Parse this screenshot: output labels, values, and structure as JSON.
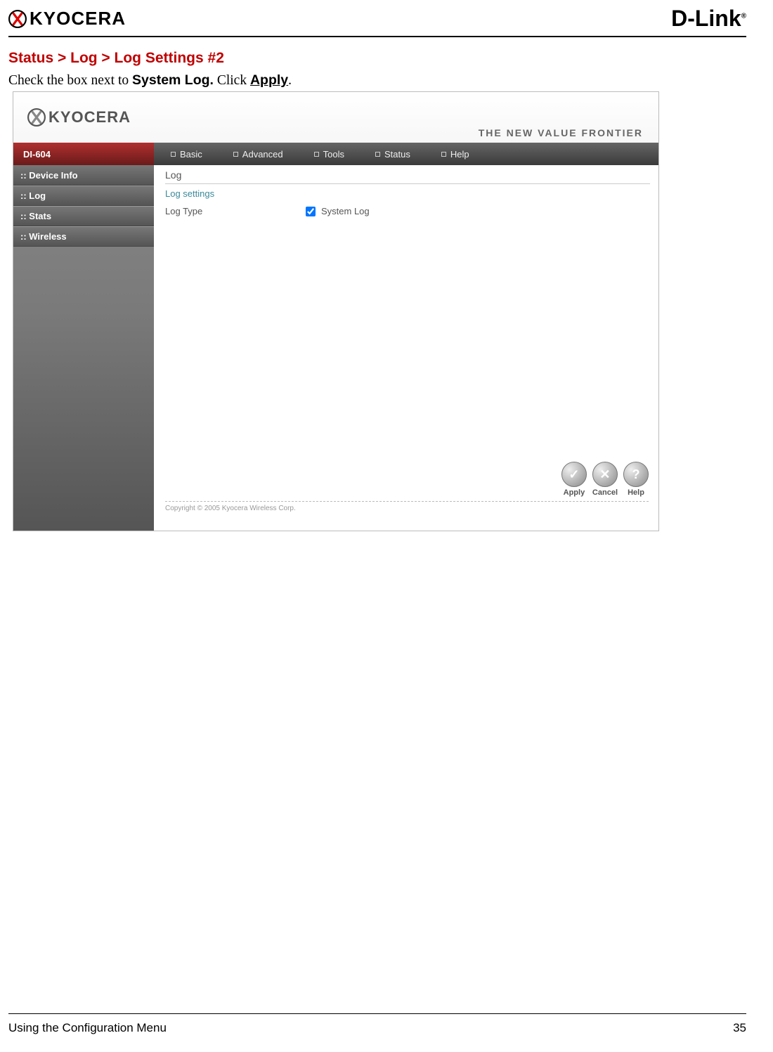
{
  "header": {
    "left_brand": "KYOCERA",
    "right_brand": "D-Link",
    "reg_mark": "®"
  },
  "breadcrumb": "Status > Log > Log Settings #2",
  "instruction": {
    "prefix": "Check the box next to ",
    "bold1": "System Log.",
    "mid": " Click ",
    "bold2": "Apply",
    "suffix": "."
  },
  "router": {
    "inner_brand": "KYOCERA",
    "tagline": "THE  NEW  VALUE  FRONTIER",
    "model": "DI-604",
    "nav": [
      "Basic",
      "Advanced",
      "Tools",
      "Status",
      "Help"
    ],
    "sidebar": [
      ":: Device Info",
      ":: Log",
      ":: Stats",
      ":: Wireless"
    ],
    "panel_title": "Log",
    "section_label": "Log settings",
    "setting_label": "Log Type",
    "checkbox_label": "System Log",
    "copyright": "Copyright © 2005 Kyocera Wireless Corp.",
    "actions": {
      "apply": "Apply",
      "cancel": "Cancel",
      "help": "Help"
    }
  },
  "footer": {
    "section": "Using the Configuration Menu",
    "page": "35"
  }
}
